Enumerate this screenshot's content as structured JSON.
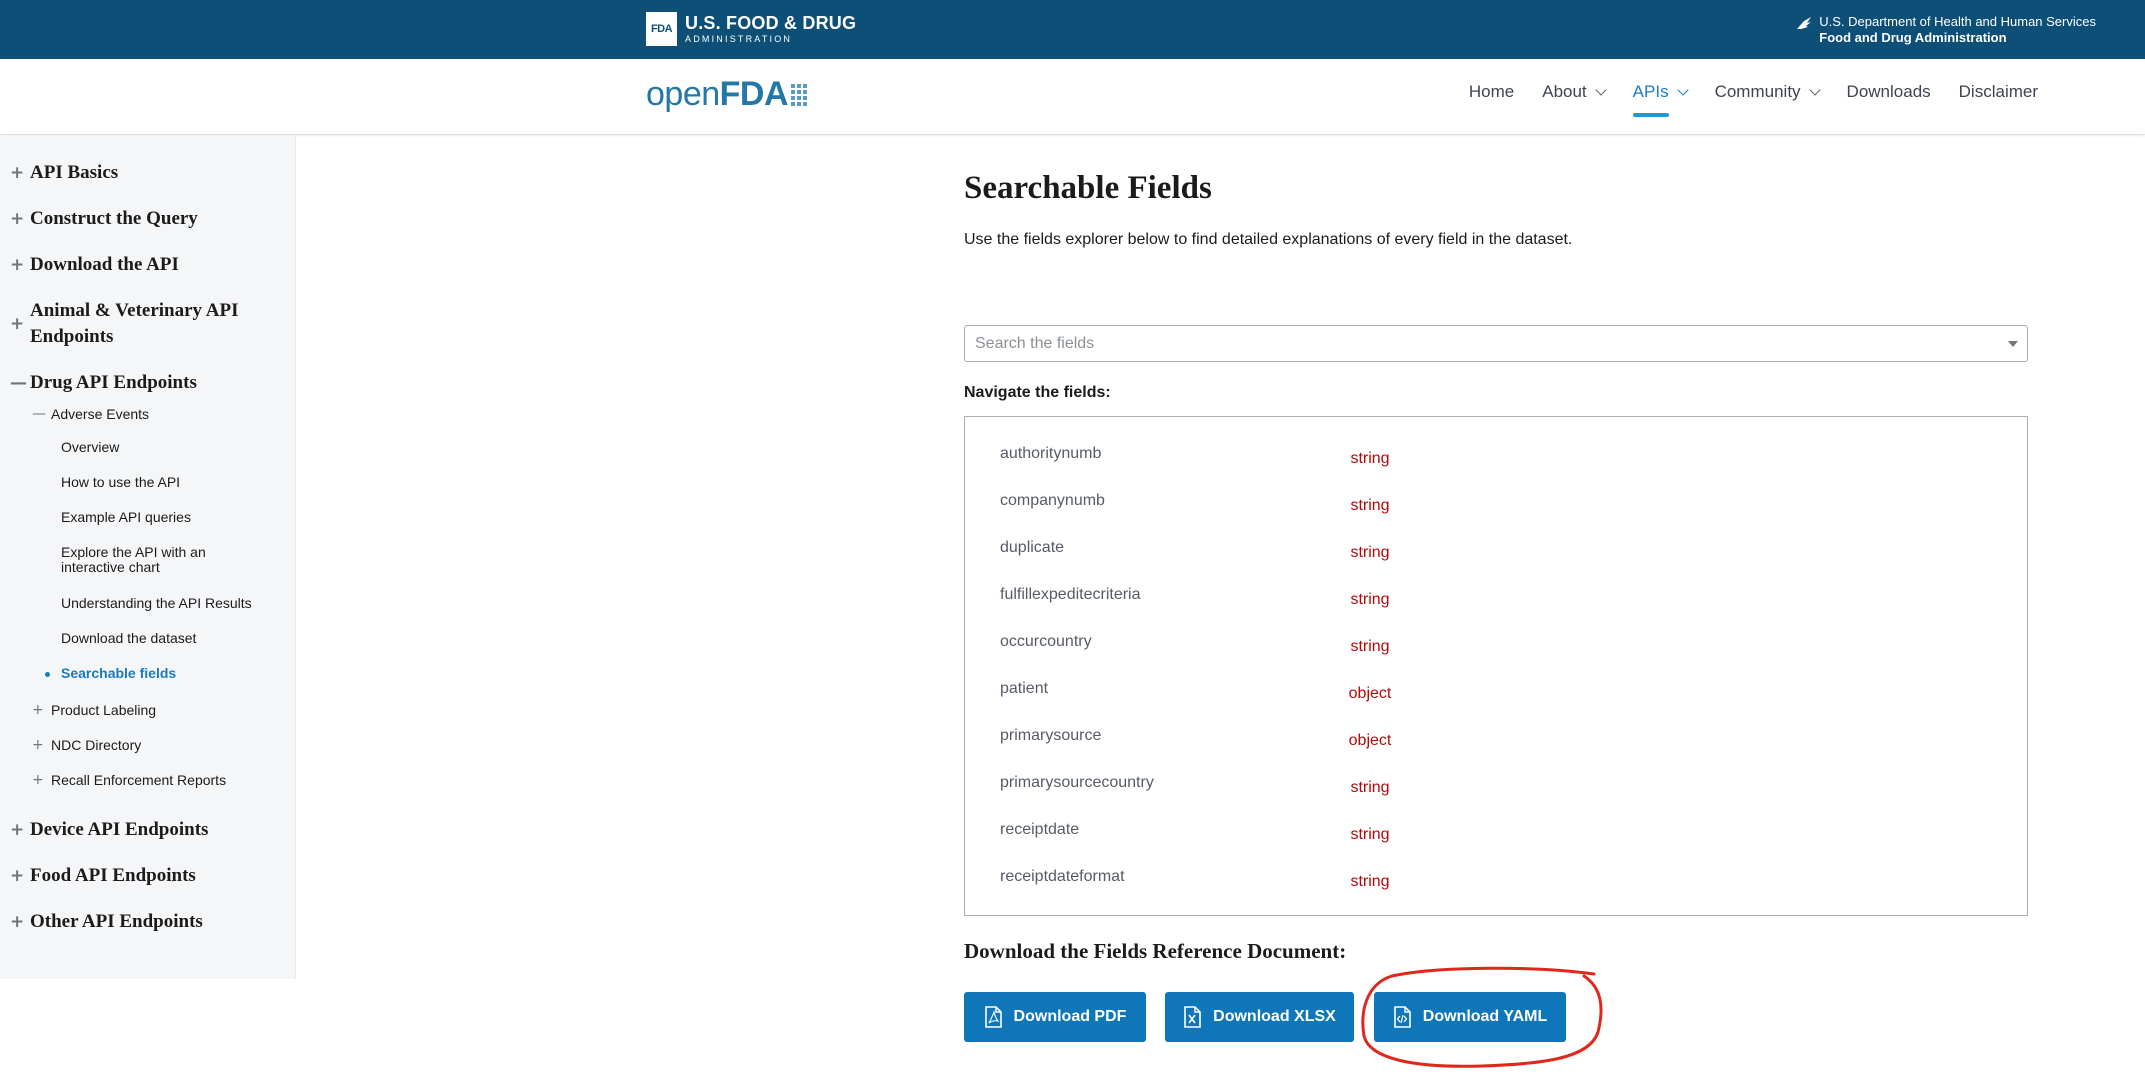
{
  "colors": {
    "header_bg": "#0d4f77",
    "link_blue": "#1a7bc1",
    "button_blue": "#0f77b9",
    "type_red": "#b50909",
    "annotation_red": "#e0271c"
  },
  "topbar": {
    "logo_box": "FDA",
    "logo_line1": "U.S. FOOD & DRUG",
    "logo_line2": "ADMINISTRATION",
    "hhs_line1": "U.S. Department of Health and Human Services",
    "hhs_line2": "Food and Drug Administration",
    "hhs_icon": "eagle-icon"
  },
  "navbar": {
    "brand_open": "open",
    "brand_fda": "FDA",
    "items": [
      {
        "label": "Home"
      },
      {
        "label": "About"
      },
      {
        "label": "APIs"
      },
      {
        "label": "Community"
      },
      {
        "label": "Downloads"
      },
      {
        "label": "Disclaimer"
      }
    ],
    "active": "APIs"
  },
  "sidebar": {
    "api_basics": "API Basics",
    "construct_query": "Construct the Query",
    "download_api": "Download the API",
    "animal_vet": "Animal & Veterinary API Endpoints",
    "drug": "Drug API Endpoints",
    "adverse_events": "Adverse Events",
    "overview": "Overview",
    "how_to_use": "How to use the API",
    "example_queries": "Example API queries",
    "explore_chart": "Explore the API with an interactive chart",
    "understanding_results": "Understanding the API Results",
    "download_dataset": "Download the dataset",
    "searchable_fields": "Searchable fields",
    "product_labeling": "Product Labeling",
    "ndc_directory": "NDC Directory",
    "recall_reports": "Recall Enforcement Reports",
    "device": "Device API Endpoints",
    "food": "Food API Endpoints",
    "other": "Other API Endpoints",
    "plus_symbol": "+",
    "minus_symbol": "—"
  },
  "main": {
    "title": "Searchable Fields",
    "description": "Use the fields explorer below to find detailed explanations of every field in the dataset.",
    "search_placeholder": "Search the fields",
    "navigate_label": "Navigate the fields:",
    "fields": [
      {
        "name": "authoritynumb",
        "type": "string"
      },
      {
        "name": "companynumb",
        "type": "string"
      },
      {
        "name": "duplicate",
        "type": "string"
      },
      {
        "name": "fulfillexpeditecriteria",
        "type": "string"
      },
      {
        "name": "occurcountry",
        "type": "string"
      },
      {
        "name": "patient",
        "type": "object"
      },
      {
        "name": "primarysource",
        "type": "object"
      },
      {
        "name": "primarysourcecountry",
        "type": "string"
      },
      {
        "name": "receiptdate",
        "type": "string"
      },
      {
        "name": "receiptdateformat",
        "type": "string"
      }
    ],
    "download_title": "Download the Fields Reference Document:",
    "buttons": {
      "pdf": "Download PDF",
      "xlsx": "Download XLSX",
      "yaml": "Download YAML"
    }
  }
}
